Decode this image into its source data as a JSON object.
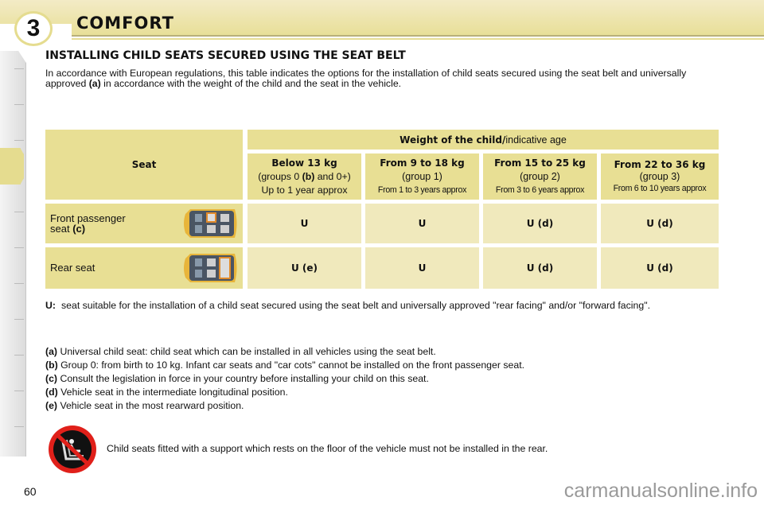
{
  "header": {
    "chapter_number": "3",
    "chapter_title": "COMFORT"
  },
  "section": {
    "title": "INSTALLING CHILD SEATS SECURED USING THE SEAT BELT",
    "intro_part1": "In accordance with European regulations, this table indicates the options for the installation of child seats secured using the seat belt and universally approved ",
    "intro_ref": "(a)",
    "intro_part2": " in accordance with the weight of the child and the seat in the vehicle."
  },
  "table": {
    "seat_header": "Seat",
    "weight_header_bold": "Weight of the child/",
    "weight_header_normal": "indicative age",
    "columns": [
      {
        "weight": "Below 13 kg",
        "group_prefix": "(groups 0 ",
        "group_ref": "(b)",
        "group_suffix": " and 0+)",
        "age": "Up to 1 year approx"
      },
      {
        "weight": "From 9 to 18 kg",
        "group": "(group 1)",
        "age": "From 1 to 3 years approx"
      },
      {
        "weight": "From 15 to 25 kg",
        "group": "(group 2)",
        "age": "From 3 to 6 years approx"
      },
      {
        "weight": "From 22 to 36 kg",
        "group": "(group 3)",
        "age": "From 6 to 10 years approx"
      }
    ],
    "rows": [
      {
        "seat": "Front passenger",
        "seat_line2": "seat ",
        "seat_ref": "(c)",
        "icon": "car-top-view-front-seat-highlighted-icon",
        "values": [
          "U",
          "U",
          "U (d)",
          "U (d)"
        ]
      },
      {
        "seat": "Rear seat",
        "icon": "car-top-view-rear-seat-highlighted-icon",
        "values": [
          "U (e)",
          "U",
          "U (d)",
          "U (d)"
        ]
      }
    ]
  },
  "legend": {
    "u_key": "U:",
    "u_text": "seat suitable for the installation of a child seat secured using the seat belt and universally approved \"rear facing\" and/or \"forward facing\".",
    "notes": [
      {
        "key": "(a)",
        "text": " Universal child seat: child seat which can be installed in all vehicles using the seat belt."
      },
      {
        "key": "(b)",
        "text": " Group 0: from birth to 10 kg. Infant car seats and \"car cots\" cannot be installed on the front passenger seat."
      },
      {
        "key": "(c)",
        "text": " Consult the legislation in force in your country before installing your child on this seat."
      },
      {
        "key": "(d)",
        "text": " Vehicle seat in the intermediate longitudinal position."
      },
      {
        "key": "(e)",
        "text": " Vehicle seat in the most rearward position."
      }
    ]
  },
  "warning": {
    "icon": "no-floor-support-child-seat-icon",
    "text": "Child seats fitted with a support which rests on the floor of the vehicle must not be installed in the rear."
  },
  "footer": {
    "page_number": "60",
    "watermark": "carmanualsonline.info"
  },
  "colors": {
    "accent": "#e8df94",
    "cell_light": "#f0e9bc",
    "warning_red": "#e0201a"
  }
}
